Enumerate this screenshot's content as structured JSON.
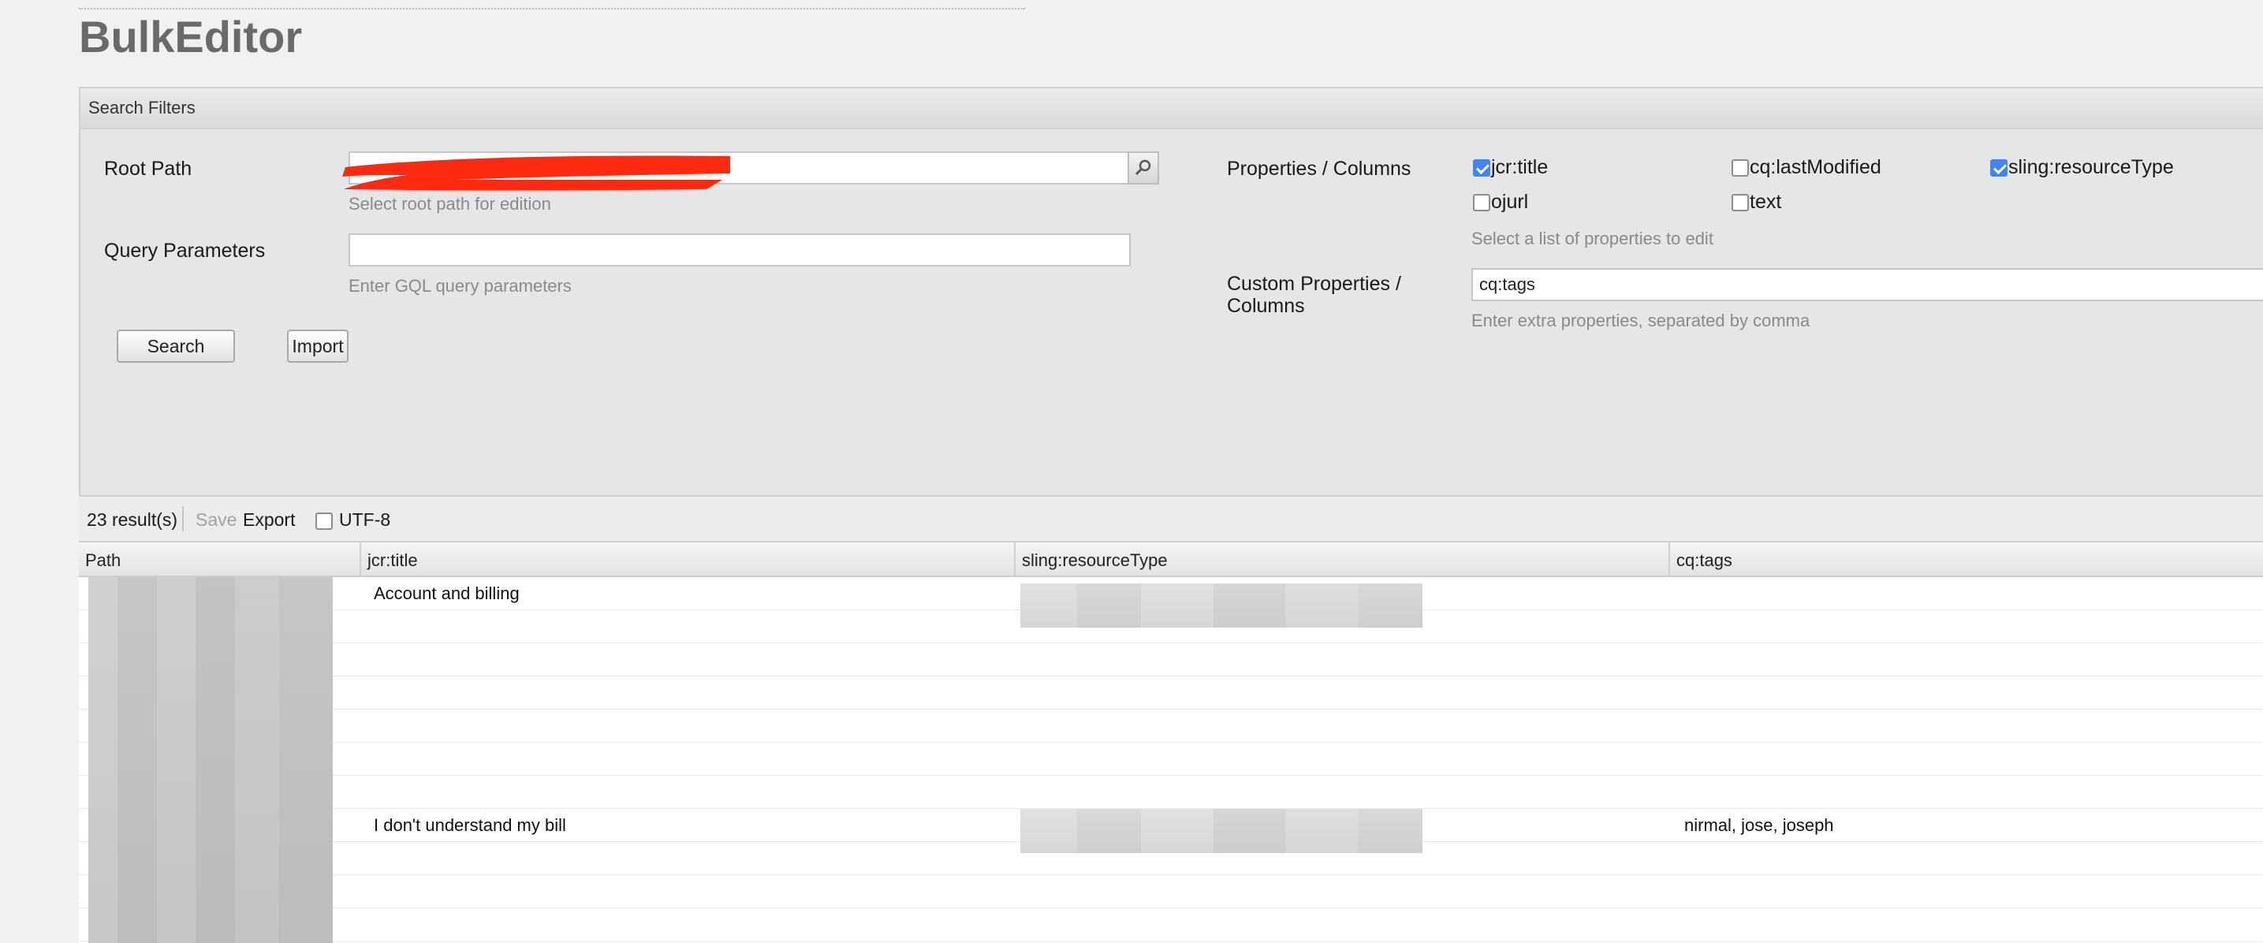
{
  "app": {
    "title": "BulkEditor"
  },
  "filters": {
    "header": "Search Filters",
    "root_path": {
      "label": "Root Path",
      "value": "",
      "hint": "Select root path for edition"
    },
    "query_params": {
      "label": "Query Parameters",
      "value": "",
      "hint": "Enter GQL query parameters"
    },
    "search_label": "Search",
    "import_label": "Import",
    "properties": {
      "label": "Properties / Columns",
      "hint": "Select a list of properties to edit",
      "options": [
        {
          "label": "jcr:title",
          "checked": true
        },
        {
          "label": "cq:lastModified",
          "checked": false
        },
        {
          "label": "sling:resourceType",
          "checked": true
        },
        {
          "label": "ojurl",
          "checked": false
        },
        {
          "label": "text",
          "checked": false
        }
      ]
    },
    "custom_properties": {
      "label_line1": "Custom Properties /",
      "label_line2": "Columns",
      "value": "cq:tags",
      "hint": "Enter extra properties, separated by comma"
    }
  },
  "results": {
    "count": "23 result(s)",
    "save_label": "Save",
    "export_label": "Export",
    "utf8_label": "UTF-8",
    "utf8_checked": false
  },
  "grid": {
    "columns": [
      "Path",
      "jcr:title",
      "sling:resourceType",
      "cq:tags"
    ],
    "rows": [
      {
        "title": "Account and billing",
        "tags": ""
      },
      {
        "title": "",
        "tags": ""
      },
      {
        "title": "",
        "tags": ""
      },
      {
        "title": "",
        "tags": ""
      },
      {
        "title": "",
        "tags": ""
      },
      {
        "title": "",
        "tags": ""
      },
      {
        "title": "",
        "tags": ""
      },
      {
        "title": "I don't understand my bill",
        "tags": "nirmal, jose, joseph"
      },
      {
        "title": "",
        "tags": ""
      },
      {
        "title": "",
        "tags": ""
      },
      {
        "title": "",
        "tags": ""
      }
    ]
  },
  "colors": {
    "checkbox_checked": "#3f86f5",
    "redaction": "#ff2a10",
    "title_gray": "#6a6a6a"
  },
  "icons": {
    "browse": "magnifier-icon"
  }
}
